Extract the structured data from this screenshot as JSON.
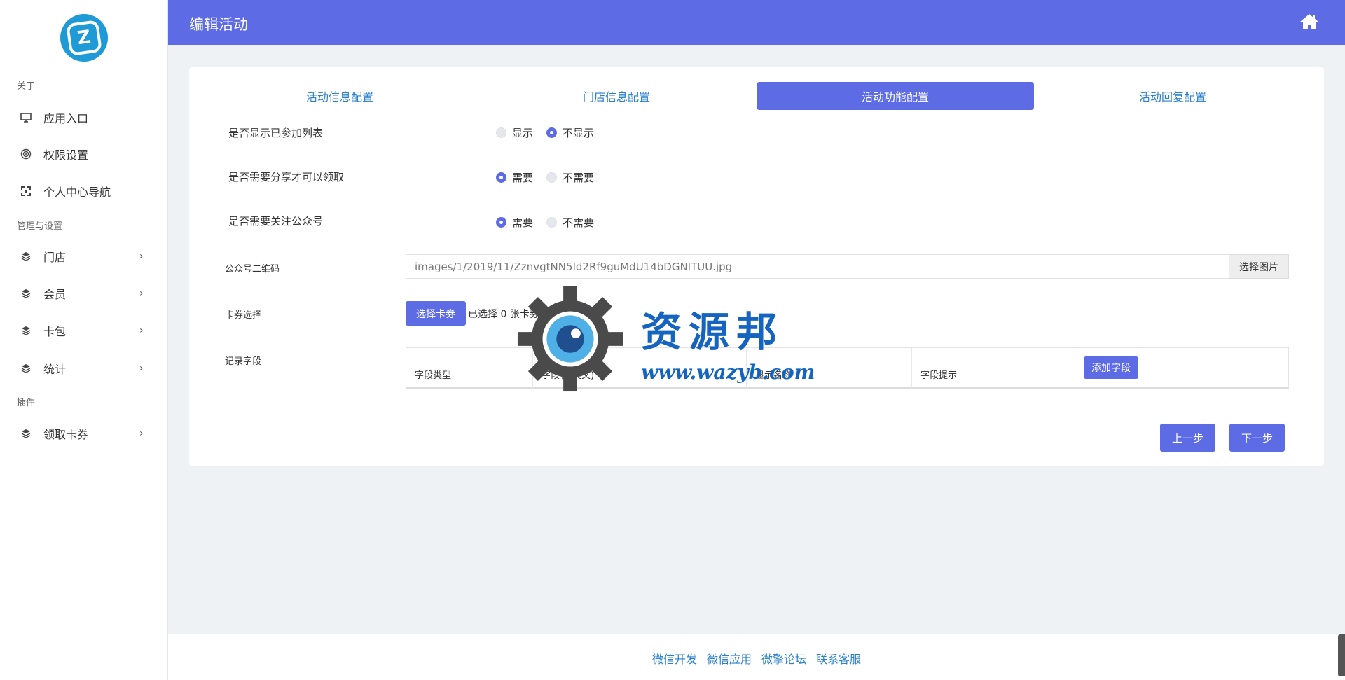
{
  "sidebar": {
    "sections": [
      "关于",
      "管理与设置",
      "插件"
    ],
    "items": [
      {
        "label": "应用入口",
        "icon": "monitor-icon"
      },
      {
        "label": "权限设置",
        "icon": "target-icon"
      },
      {
        "label": "个人中心导航",
        "icon": "expand-icon"
      },
      {
        "label": "门店",
        "icon": "layers-icon"
      },
      {
        "label": "会员",
        "icon": "layers-icon"
      },
      {
        "label": "卡包",
        "icon": "layers-icon"
      },
      {
        "label": "统计",
        "icon": "layers-icon"
      },
      {
        "label": "领取卡券",
        "icon": "layers-icon"
      }
    ]
  },
  "header": {
    "title": "编辑活动",
    "icon": "home-icon"
  },
  "tabs": [
    "活动信息配置",
    "门店信息配置",
    "活动功能配置",
    "活动回复配置"
  ],
  "active_tab": "活动功能配置",
  "form": {
    "show_joined": {
      "label": "是否显示已参加列表",
      "options": [
        "显示",
        "不显示"
      ],
      "selected": "不显示"
    },
    "share_required": {
      "label": "是否需要分享才可以领取",
      "options": [
        "需要",
        "不需要"
      ],
      "selected": "需要"
    },
    "follow_required": {
      "label": "是否需要关注公众号",
      "options": [
        "需要",
        "不需要"
      ],
      "selected": "需要"
    },
    "qrcode": {
      "label": "公众号二维码",
      "value": "images/1/2019/11/ZznvgtNN5Id2Rf9guMdU14bDGNITUU.jpg",
      "button": "选择图片"
    },
    "coupon": {
      "label": "卡券选择",
      "button": "选择卡券",
      "info": "已选择 0 张卡券"
    },
    "record": {
      "label": "记录字段",
      "columns": [
        "字段类型",
        "字段名(英文)",
        "显示名称",
        "字段提示"
      ],
      "add_button": "添加字段"
    }
  },
  "actions": {
    "prev": "上一步",
    "next": "下一步"
  },
  "watermark": {
    "title": "资源邦",
    "url": "www.wazyb.com"
  },
  "footer": {
    "links": [
      "微信开发",
      "微信应用",
      "微擎论坛",
      "联系客服"
    ]
  },
  "colors": {
    "primary": "#5d6be4",
    "link": "#2a80cf",
    "bg": "#eef2f5"
  }
}
